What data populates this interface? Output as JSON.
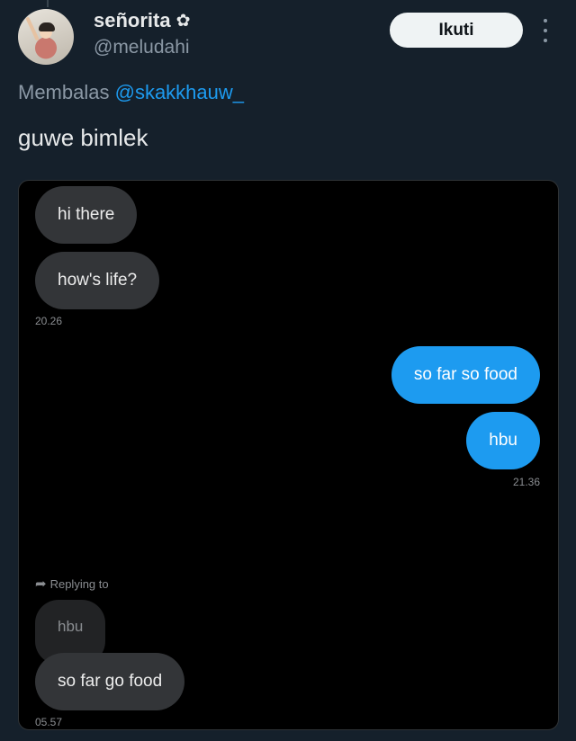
{
  "user": {
    "display_name": "señorita",
    "badge_icon": "flower-icon",
    "handle": "@meludahi"
  },
  "follow_label": "Ikuti",
  "reply": {
    "prefix": "Membalas",
    "mention": "@skakkhauw_"
  },
  "tweet_text": "guwe bimlek",
  "chat": {
    "messages": [
      {
        "text": "hi there"
      },
      {
        "text": "how's life?"
      },
      {
        "text": "so far so food"
      },
      {
        "text": "hbu"
      },
      {
        "text": "hbu"
      },
      {
        "text": "so far go food"
      }
    ],
    "timestamps": [
      "20.26",
      "21.36",
      "05.57"
    ],
    "replying_label": "Replying to"
  },
  "colors": {
    "background": "#15202b",
    "outgoing_bubble": "#1d9bf0",
    "incoming_bubble": "#333538",
    "follow_button": "#eff3f4"
  }
}
